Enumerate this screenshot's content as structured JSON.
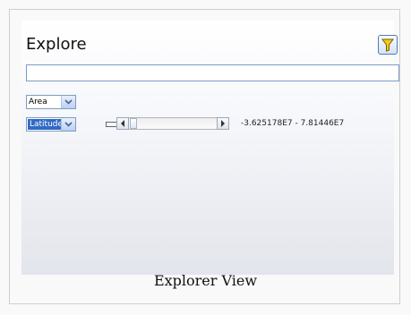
{
  "panel": {
    "title": "Explore",
    "filter_icon": "funnel-icon",
    "search": {
      "value": "",
      "placeholder": ""
    },
    "group_select": {
      "value": "Area",
      "icon": "chevron-down-icon"
    },
    "attribute_select": {
      "value": "Latitude",
      "icon": "chevron-down-icon"
    },
    "range_slider": {
      "left_arrow_icon": "arrow-left-icon",
      "right_arrow_icon": "arrow-right-icon",
      "range_text": "-3.625178E7 - 7.81446E7"
    }
  },
  "caption": "Explorer View",
  "colors": {
    "accent": "#316ac5",
    "filter_icon": "#e8c31b"
  }
}
